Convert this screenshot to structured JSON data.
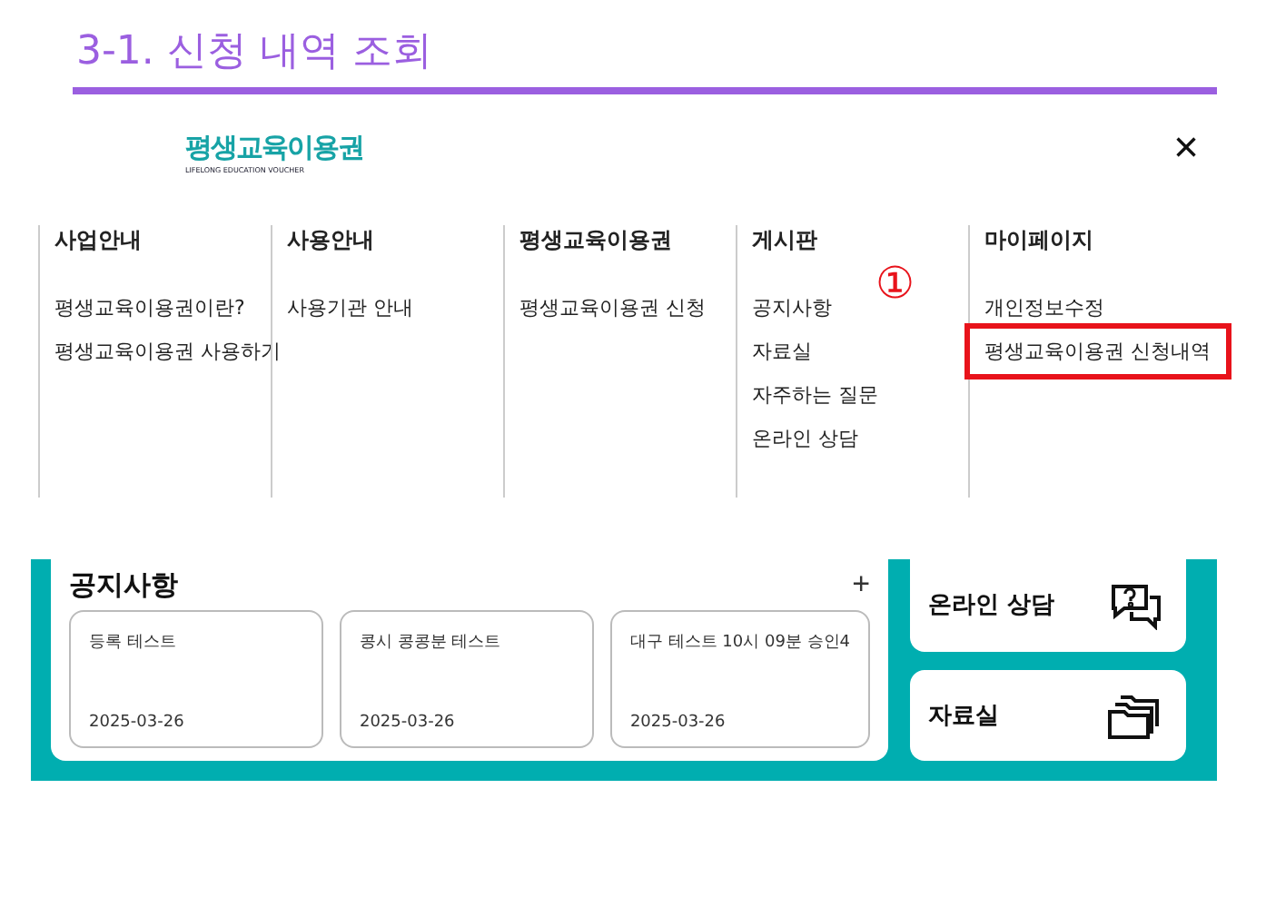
{
  "section_title": "3-1. 신청 내역 조회",
  "logo": {
    "text": "평생교육이용권",
    "subtitle": "LIFELONG EDUCATION VOUCHER"
  },
  "close_button": "×",
  "menu_columns": [
    {
      "heading": "사업안내",
      "items": [
        {
          "label": "평생교육이용권이란?",
          "highlighted": false
        },
        {
          "label": "평생교육이용권 사용하기",
          "highlighted": false
        }
      ]
    },
    {
      "heading": "사용안내",
      "items": [
        {
          "label": "사용기관 안내",
          "highlighted": false
        }
      ]
    },
    {
      "heading": "평생교육이용권",
      "items": [
        {
          "label": "평생교육이용권 신청",
          "highlighted": false
        }
      ]
    },
    {
      "heading": "게시판",
      "items": [
        {
          "label": "공지사항",
          "highlighted": false
        },
        {
          "label": "자료실",
          "highlighted": false
        },
        {
          "label": "자주하는 질문",
          "highlighted": false
        },
        {
          "label": "온라인 상담",
          "highlighted": false
        }
      ]
    },
    {
      "heading": "마이페이지",
      "step_marker": "①",
      "items": [
        {
          "label": "개인정보수정",
          "highlighted": false
        },
        {
          "label": "평생교육이용권 신청내역",
          "highlighted": true
        }
      ]
    }
  ],
  "notices": {
    "title": "공지사항",
    "more": "+",
    "cards": [
      {
        "title": "등록 테스트",
        "date": "2025-03-26"
      },
      {
        "title": "콩시 콩콩분 테스트",
        "date": "2025-03-26"
      },
      {
        "title": "대구 테스트 10시 09분 승인4",
        "date": "2025-03-26"
      }
    ]
  },
  "quick_tiles": [
    {
      "label": "온라인 상담",
      "kind": "chat"
    },
    {
      "label": "자료실",
      "kind": "folder"
    }
  ]
}
